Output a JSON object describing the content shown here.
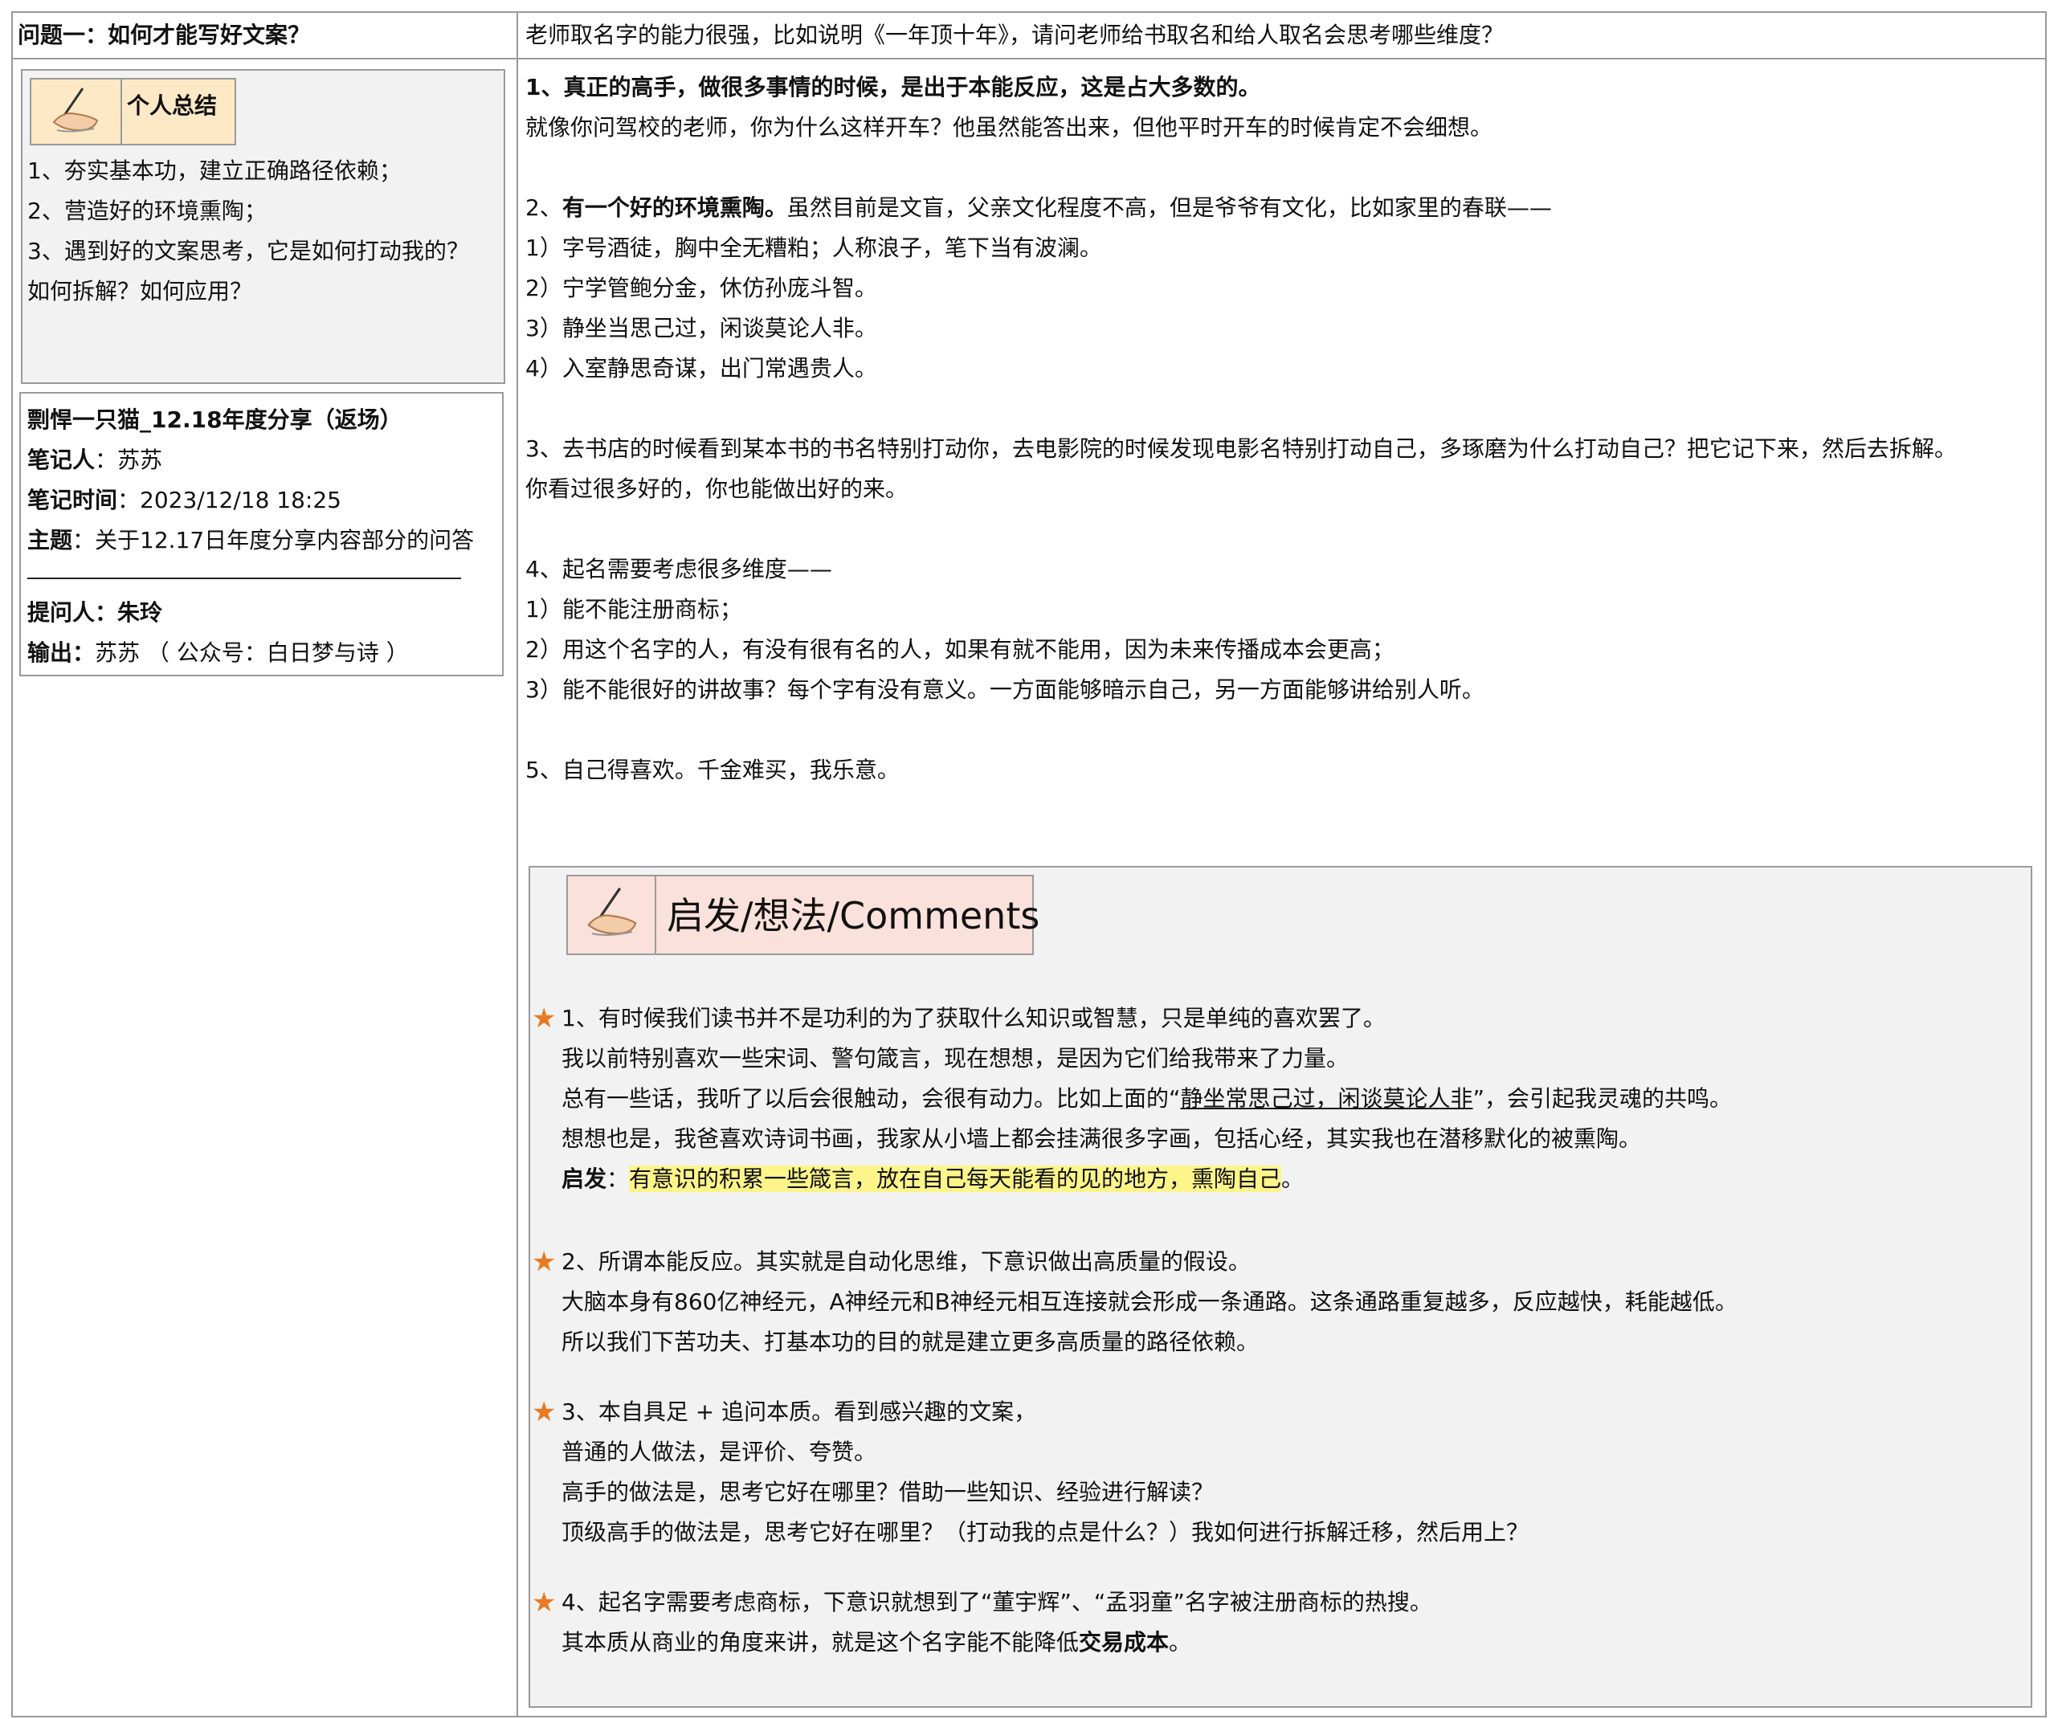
{
  "header": {
    "question": "问题一：如何才能写好文案？",
    "prompt": "老师取名字的能力很强，比如说明《一年顶十年》，请问老师给书取名和给人取名会思考哪些维度？"
  },
  "summary": {
    "title": "个人总结",
    "items": [
      "1、夯实基本功，建立正确路径依赖；",
      "2、营造好的环境熏陶；",
      "3、遇到好的文案思考，它是如何打动我的？",
      "如何拆解？如何应用？"
    ]
  },
  "meta": {
    "title": "剽悍一只猫_12.18年度分享（返场）",
    "recorder_label": "笔记人",
    "recorder": "：苏苏",
    "time_label": "笔记时间",
    "time": "：2023/12/18 18:25",
    "topic_label": "主题",
    "topic": "：关于12.17日年度分享内容部分的问答",
    "asker": "提问人：朱玲",
    "output_label": "输出：",
    "output": "苏苏 （ 公众号：白日梦与诗 ）"
  },
  "answer": {
    "p1_bold": "1、真正的高手，做很多事情的时候，是出于本能反应，这是占大多数的。",
    "p1_line2": "就像你问驾校的老师，你为什么这样开车？他虽然能答出来，但他平时开车的时候肯定不会细想。",
    "p2_prefix": "2、",
    "p2_bold": "有一个好的环境熏陶。",
    "p2_rest": "虽然目前是文盲，父亲文化程度不高，但是爷爷有文化，比如家里的春联——",
    "couplets": [
      "1）字号酒徒，胸中全无糟粕；人称浪子，笔下当有波澜。",
      "2）宁学管鲍分金，休仿孙庞斗智。",
      "3）静坐当思己过，闲谈莫论人非。",
      "4）入室静思奇谋，出门常遇贵人。"
    ],
    "p3_line1": "3、去书店的时候看到某本书的书名特别打动你，去电影院的时候发现电影名特别打动自己，多琢磨为什么打动自己？把它记下来，然后去拆解。",
    "p3_line2": "你看过很多好的，你也能做出好的来。",
    "p4_head": "4、起名需要考虑很多维度——",
    "p4_items": [
      "1）能不能注册商标；",
      "2）用这个名字的人，有没有很有名的人，如果有就不能用，因为未来传播成本会更高；",
      "3）能不能很好的讲故事？每个字有没有意义。一方面能够暗示自己，另一方面能够讲给别人听。"
    ],
    "p5": "5、自己得喜欢。千金难买，我乐意。"
  },
  "comments": {
    "title": "启发/想法/Comments",
    "c1_line1": "1、有时候我们读书并不是功利的为了获取什么知识或智慧，只是单纯的喜欢罢了。",
    "c1_line2": "我以前特别喜欢一些宋词、警句箴言，现在想想，是因为它们给我带来了力量。",
    "c1_line3_a": "总有一些话，我听了以后会很触动，会很有动力。比如上面的“",
    "c1_line3_u": "静坐常思己过，闲谈莫论人非",
    "c1_line3_b": "”，会引起我灵魂的共鸣。",
    "c1_line4": "想想也是，我爸喜欢诗词书画，我家从小墙上都会挂满很多字画，包括心经，其实我也在潜移默化的被熏陶。",
    "c1_label": "启发",
    "c1_colon": "：",
    "c1_highlight": "有意识的积累一些箴言，放在自己每天能看的见的地方，熏陶自己",
    "c1_end": "。",
    "c2_line1": "2、所谓本能反应。其实就是自动化思维，下意识做出高质量的假设。",
    "c2_line2": "大脑本身有860亿神经元，A神经元和B神经元相互连接就会形成一条通路。这条通路重复越多，反应越快，耗能越低。",
    "c2_line3": "所以我们下苦功夫、打基本功的目的就是建立更多高质量的路径依赖。",
    "c3_line1": "3、本自具足 + 追问本质。看到感兴趣的文案，",
    "c3_line2": "普通的人做法，是评价、夸赞。",
    "c3_line3": "高手的做法是，思考它好在哪里？借助一些知识、经验进行解读？",
    "c3_line4": "顶级高手的做法是，思考它好在哪里？（打动我的点是什么？）我如何进行拆解迁移，然后用上？",
    "c4_line1": "4、起名字需要考虑商标，下意识就想到了“董宇辉”、“孟羽童”名字被注册商标的热搜。",
    "c4_line2_a": "其本质从商业的角度来讲，就是这个名字能不能降低",
    "c4_line2_b": "交易成本",
    "c4_line2_c": "。",
    "star": "★"
  },
  "colors": {
    "border": "#9a9a9a",
    "summary_bg": "#f2f2f2",
    "tag_bg": "#fde9c6",
    "comments_tag_bg": "#fbe1db",
    "star": "#ea7a22",
    "highlight": "#fdf58a"
  },
  "icons": [
    "writing-hand-icon",
    "star-icon"
  ]
}
